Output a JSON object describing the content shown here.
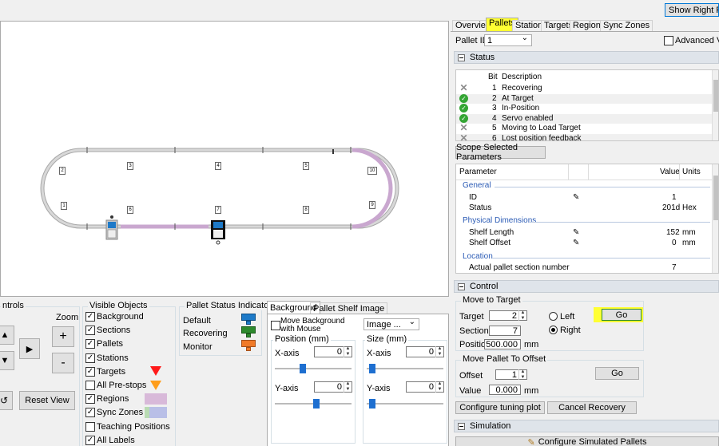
{
  "top_button": "Show Right Panel",
  "tabs": [
    "Overview",
    "Pallets",
    "Stations",
    "Targets",
    "Regions",
    "Sync Zones"
  ],
  "pallet_id_label": "Pallet ID",
  "pallet_id_value": "1",
  "advanced_view": "Advanced View",
  "status": {
    "title": "Status",
    "col_bit": "Bit",
    "col_desc": "Description",
    "rows": [
      {
        "state": "no",
        "bit": "1",
        "desc": "Recovering"
      },
      {
        "state": "ok",
        "bit": "2",
        "desc": "At Target"
      },
      {
        "state": "ok",
        "bit": "3",
        "desc": "In-Position"
      },
      {
        "state": "ok",
        "bit": "4",
        "desc": "Servo enabled"
      },
      {
        "state": "no",
        "bit": "5",
        "desc": "Moving to Load Target"
      },
      {
        "state": "no",
        "bit": "6",
        "desc": "Lost position feedback"
      }
    ]
  },
  "scope_button": "Scope Selected Parameters",
  "params": {
    "col_param": "Parameter",
    "col_value": "Value",
    "col_units": "Units",
    "general": "General",
    "id_label": "ID",
    "id_value": "1",
    "status_label": "Status",
    "status_value": "201d",
    "status_units": "Hex",
    "physical": "Physical Dimensions",
    "shelf_length_label": "Shelf Length",
    "shelf_length_value": "152",
    "shelf_length_units": "mm",
    "shelf_offset_label": "Shelf Offset",
    "shelf_offset_value": "0",
    "shelf_offset_units": "mm",
    "location": "Location",
    "actual_section_label": "Actual pallet section number",
    "actual_section_value": "7"
  },
  "control": {
    "title": "Control",
    "move_to_target": "Move to Target",
    "target_label": "Target",
    "target_value": "2",
    "section_label": "Section",
    "section_value": "7",
    "position_label": "Position",
    "position_value": "500.000",
    "position_units": "mm",
    "left": "Left",
    "right": "Right",
    "go": "Go",
    "move_pallet_offset": "Move Pallet To Offset",
    "offset_label": "Offset",
    "offset_value": "1",
    "value_label": "Value",
    "value_value": "0.000",
    "value_units": "mm",
    "go2": "Go",
    "configure_tuning": "Configure tuning plot",
    "cancel_recovery": "Cancel Recovery"
  },
  "simulation": {
    "title": "Simulation",
    "configure_sim": "Configure Simulated Pallets"
  },
  "track": {
    "section_labels": [
      "1",
      "2",
      "3",
      "4",
      "5",
      "6",
      "7",
      "8",
      "9",
      "10"
    ]
  },
  "bottom": {
    "controls_title": "ntrols",
    "zoom_label": "Zoom",
    "plus": "+",
    "minus": "-",
    "reset_view": "Reset View",
    "visible_objects_title": "Visible Objects",
    "visible_objects": [
      {
        "label": "Background",
        "checked": true
      },
      {
        "label": "Sections",
        "checked": true
      },
      {
        "label": "Pallets",
        "checked": true
      },
      {
        "label": "Stations",
        "checked": true
      },
      {
        "label": "Targets",
        "checked": true
      },
      {
        "label": "All Pre-stops",
        "checked": false
      },
      {
        "label": "Regions",
        "checked": true
      },
      {
        "label": "Sync Zones",
        "checked": true
      },
      {
        "label": "Teaching Positions",
        "checked": false
      },
      {
        "label": "All Labels",
        "checked": true
      }
    ],
    "pallet_status_title": "Pallet Status Indicator",
    "status_default": "Default",
    "status_recovering": "Recovering",
    "status_monitor": "Monitor",
    "bg_tab": "Background",
    "shelf_tab": "Pallet Shelf Image",
    "move_bg_line1": "Move Background",
    "move_bg_line2": "with Mouse",
    "image_select": "Image ...",
    "position_title": "Position (mm)",
    "size_title": "Size (mm)",
    "x_axis": "X-axis",
    "y_axis": "Y-axis",
    "pos_x": "0",
    "pos_y": "0",
    "size_x": "0",
    "size_y": "0"
  },
  "colors": {
    "highlight": "#ffff33",
    "default_status": "#1e7ac8",
    "recovering_status": "#2d8a2d",
    "monitor_status": "#f07a28",
    "region_purple": "#c9a7cf"
  }
}
